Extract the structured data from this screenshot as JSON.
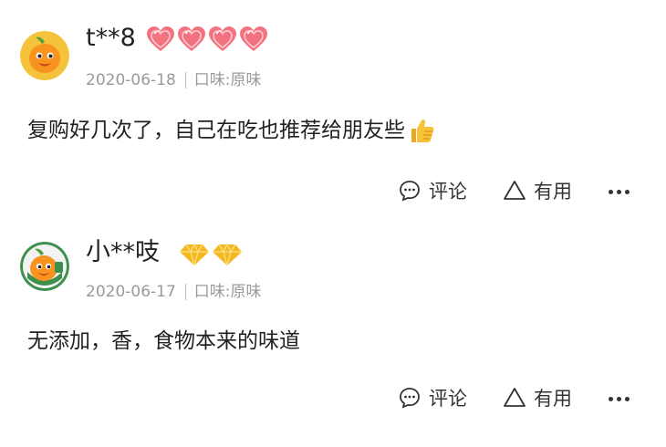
{
  "reviews": [
    {
      "username": "t**8",
      "date": "2020-06-18",
      "taste": "口味:原味",
      "content": "复购好几次了，自己在吃也推荐给朋友些",
      "actions": {
        "comment_label": "评论",
        "useful_label": "有用"
      }
    },
    {
      "username": "小**吱",
      "date": "2020-06-17",
      "taste": "口味:原味",
      "content": "无添加，香，食物本来的味道",
      "actions": {
        "comment_label": "评论",
        "useful_label": "有用"
      }
    }
  ],
  "icons": {
    "avatar": "orange-mascot-avatar",
    "badge_1": "heart-badge-icon",
    "badge_2": "diamond-badge-icon",
    "emoji": "thumbs-up-icon",
    "comment": "comment-icon",
    "useful": "triangle-up-icon",
    "more": "more-dots-icon"
  },
  "colors": {
    "heart": "#f4727f",
    "diamond": "#f5b920",
    "mascot": "#f7931e",
    "avatar_bg_1": "#f5c33b",
    "avatar_bg_2": "#f3f3f3",
    "avatar_ring_2": "#3e8f4c",
    "meta_text": "#9a9a9a"
  }
}
